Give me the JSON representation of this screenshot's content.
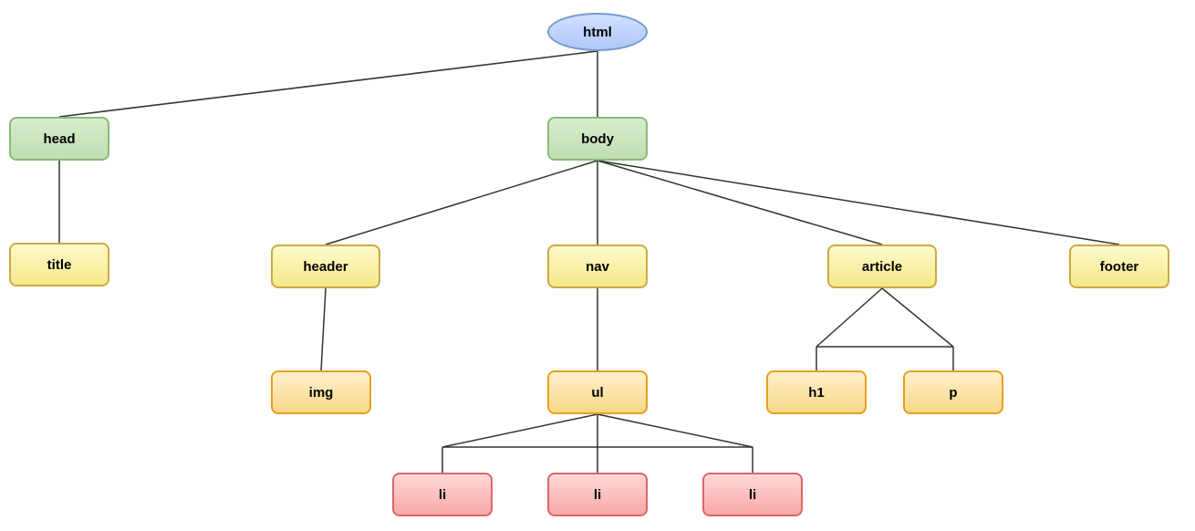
{
  "nodes": {
    "html": {
      "label": "html"
    },
    "head": {
      "label": "head"
    },
    "body": {
      "label": "body"
    },
    "title": {
      "label": "title"
    },
    "header": {
      "label": "header"
    },
    "nav": {
      "label": "nav"
    },
    "article": {
      "label": "article"
    },
    "footer": {
      "label": "footer"
    },
    "img": {
      "label": "img"
    },
    "ul": {
      "label": "ul"
    },
    "h1": {
      "label": "h1"
    },
    "p": {
      "label": "p"
    },
    "li1": {
      "label": "li"
    },
    "li2": {
      "label": "li"
    },
    "li3": {
      "label": "li"
    }
  }
}
